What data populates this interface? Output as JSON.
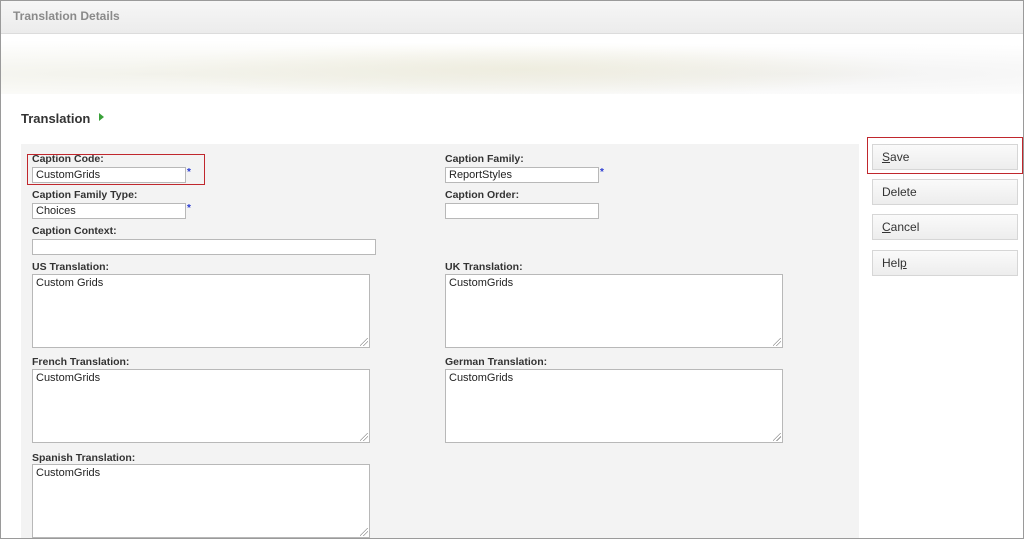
{
  "window": {
    "title": "Translation Details"
  },
  "section": {
    "heading": "Translation"
  },
  "form": {
    "caption_code": {
      "label": "Caption Code:",
      "value": "CustomGrids",
      "required_mark": "*"
    },
    "caption_family": {
      "label": "Caption Family:",
      "value": "ReportStyles",
      "required_mark": "*"
    },
    "caption_family_type": {
      "label": "Caption Family Type:",
      "value": "Choices",
      "required_mark": "*"
    },
    "caption_order": {
      "label": "Caption Order:",
      "value": ""
    },
    "caption_context": {
      "label": "Caption Context:",
      "value": ""
    },
    "us_translation": {
      "label": "US Translation:",
      "value": "Custom Grids"
    },
    "uk_translation": {
      "label": "UK Translation:",
      "value": "CustomGrids"
    },
    "french_translation": {
      "label": "French Translation:",
      "value": "CustomGrids"
    },
    "german_translation": {
      "label": "German Translation:",
      "value": "CustomGrids"
    },
    "spanish_translation": {
      "label": "Spanish Translation:",
      "value": "CustomGrids"
    }
  },
  "actions": {
    "save": {
      "key": "S",
      "rest": "ave"
    },
    "delete": {
      "label": "Delete"
    },
    "cancel": {
      "key": "C",
      "rest": "ancel"
    },
    "help": {
      "pre": "Hel",
      "key": "p"
    }
  },
  "colors": {
    "highlight_border": "#c0272d",
    "required_mark": "#2a3bd1",
    "section_arrow": "#3aa13a"
  },
  "icons": [
    "section-expand-arrow-icon",
    "textarea-resize-grip-icon"
  ]
}
